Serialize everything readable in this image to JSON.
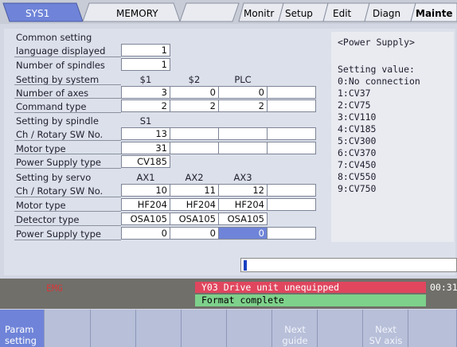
{
  "tabs": {
    "sys": "SYS1",
    "memory": "MEMORY",
    "monitor": "Monitr",
    "setup": "Setup",
    "edit": "Edit",
    "diagn": "Diagn",
    "mainte": "Mainte"
  },
  "params": {
    "common": {
      "title": "Common setting",
      "language_label": "language displayed",
      "language_value": "1",
      "spindles_label": "Number of spindles",
      "spindles_value": "1"
    },
    "system": {
      "title": "Setting by system",
      "headers": [
        "$1",
        "$2",
        "PLC"
      ],
      "axes_label": "Number of axes",
      "axes_values": [
        "3",
        "0",
        "0"
      ],
      "cmd_label": "Command type",
      "cmd_values": [
        "2",
        "2",
        "2"
      ]
    },
    "spindle": {
      "title": "Setting by spindle",
      "header": "S1",
      "ch_label": "Ch / Rotary SW No.",
      "ch_value": "13",
      "motor_label": "Motor type",
      "motor_value": "31",
      "power_label": "Power Supply type",
      "power_value": "CV185"
    },
    "servo": {
      "title": "Setting by servo",
      "headers": [
        "AX1",
        "AX2",
        "AX3"
      ],
      "ch_label": "Ch / Rotary SW No.",
      "ch_values": [
        "10",
        "11",
        "12"
      ],
      "motor_label": "Motor type",
      "motor_values": [
        "HF204",
        "HF204",
        "HF204"
      ],
      "detector_label": "Detector type",
      "detector_values": [
        "OSA105",
        "OSA105",
        "OSA105"
      ],
      "power_label": "Power Supply type",
      "power_values": [
        "0",
        "0",
        "0"
      ]
    }
  },
  "guide": {
    "title": "<Power Supply>",
    "heading": "Setting value:",
    "options": [
      "0:No connection",
      "1:CV37",
      "2:CV75",
      "3:CV110",
      "4:CV185",
      "5:CV300",
      "6:CV370",
      "7:CV450",
      "8:CV550",
      "9:CV750"
    ]
  },
  "status": {
    "alarm_code": "EMG",
    "alarm_message": "Y03  Drive unit unequipped",
    "time": "00:31",
    "message": "Format complete"
  },
  "softkeys": {
    "param_setting_line1": "Param",
    "param_setting_line2": "setting",
    "next_guide_line1": "Next",
    "next_guide_line2": "guide",
    "next_sv_line1": "Next",
    "next_sv_line2": "SV axis"
  },
  "colors": {
    "accent": "#6f84d8",
    "alarm": "#e0465e",
    "ok": "#7ed18b"
  }
}
